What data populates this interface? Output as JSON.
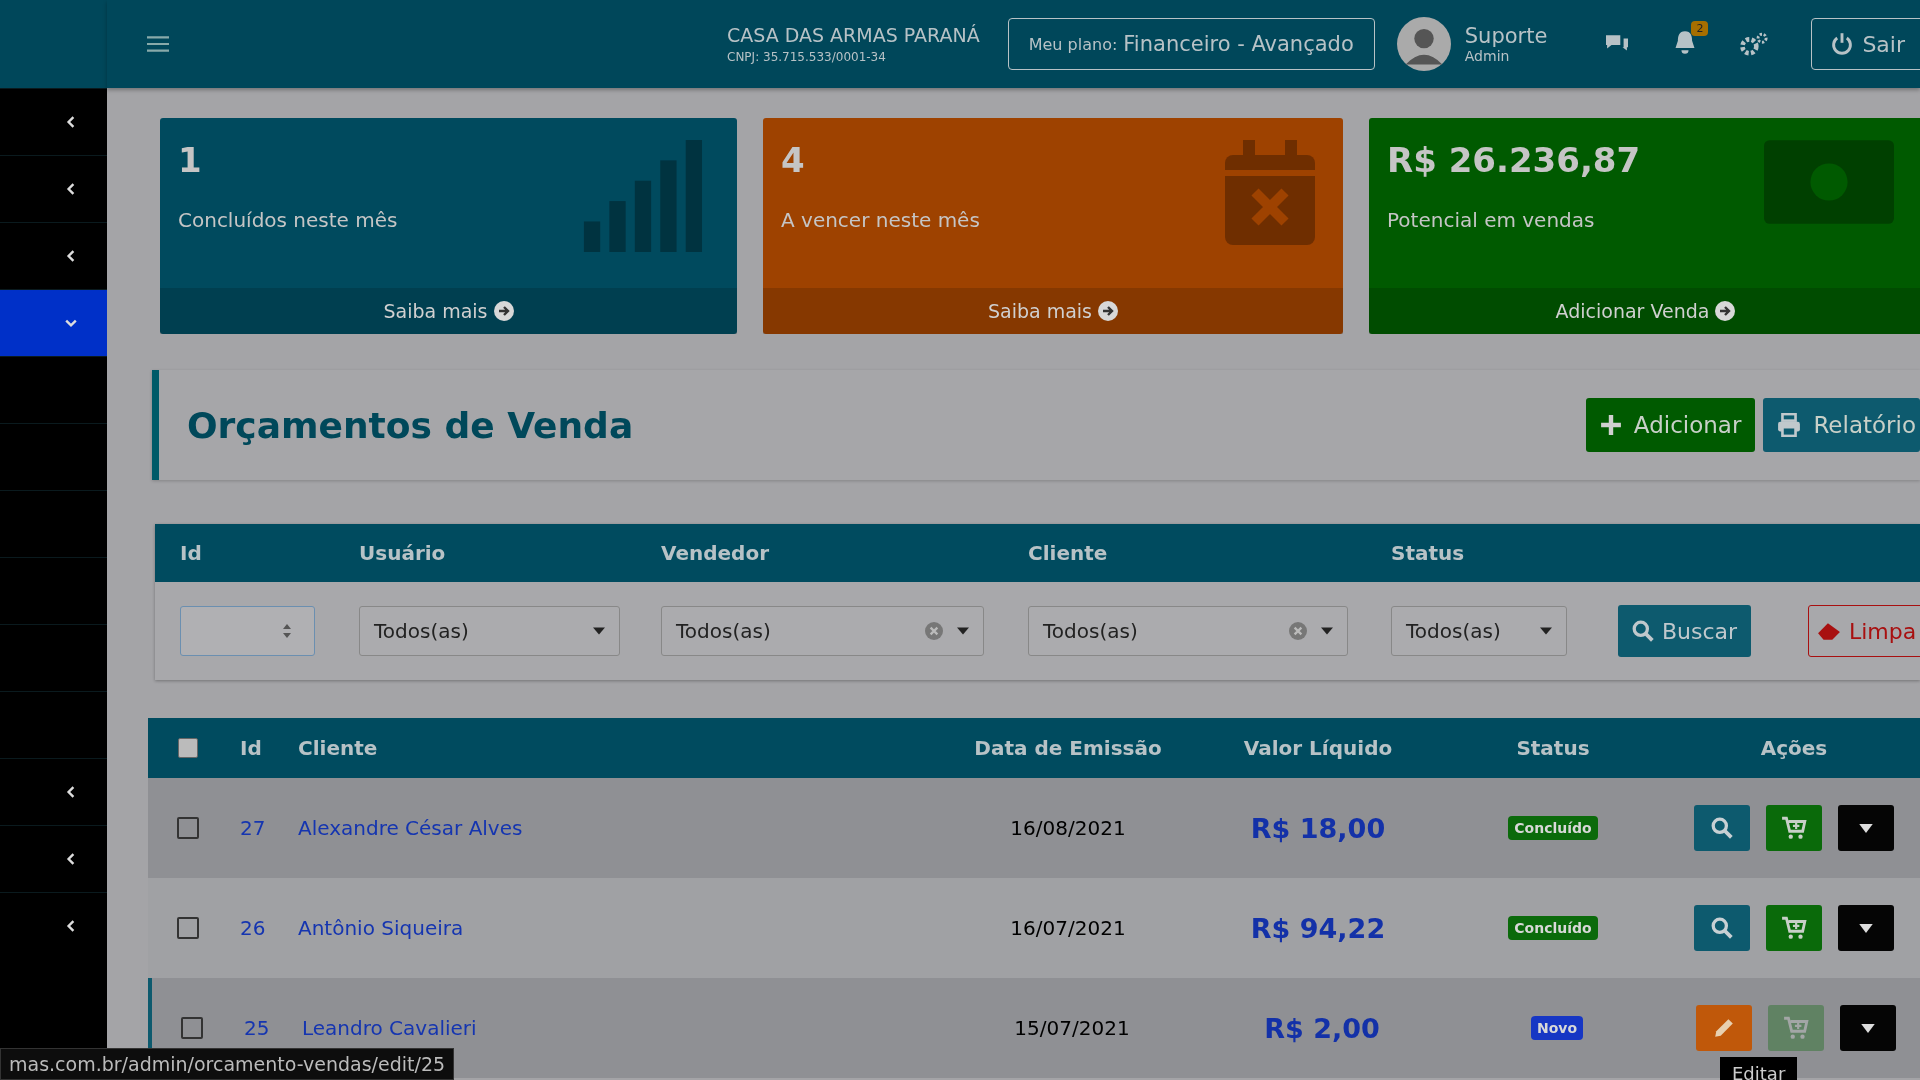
{
  "topbar": {
    "company": "CASA DAS ARMAS PARANÁ",
    "cnpj": "CNPJ: 35.715.533/0001-34",
    "plan_label": "Meu plano:",
    "plan": "Financeiro - Avançado",
    "user_name": "Suporte",
    "user_role": "Admin",
    "notification_count": "2",
    "logout": "Sair"
  },
  "sidebar": {
    "items": [
      {
        "kind": "group",
        "expanded": false,
        "selected": false
      },
      {
        "kind": "group",
        "expanded": false,
        "selected": false
      },
      {
        "kind": "group",
        "expanded": false,
        "selected": false
      },
      {
        "kind": "group",
        "expanded": true,
        "selected": true
      },
      {
        "kind": "link",
        "selected": false
      },
      {
        "kind": "link",
        "selected": false
      },
      {
        "kind": "link",
        "selected": false
      },
      {
        "kind": "link",
        "selected": false
      },
      {
        "kind": "link",
        "selected": false
      },
      {
        "kind": "link",
        "selected": false
      },
      {
        "kind": "group",
        "expanded": false,
        "selected": false
      },
      {
        "kind": "group",
        "expanded": false,
        "selected": false
      },
      {
        "kind": "group",
        "expanded": false,
        "selected": false
      }
    ]
  },
  "cards": [
    {
      "kind": "bars",
      "value": "1",
      "label": "Concluídos neste mês",
      "link": "Saiba mais",
      "color": "#004a5e"
    },
    {
      "kind": "calendar",
      "value": "4",
      "label": "A vencer neste mês",
      "link": "Saiba mais",
      "color": "#9e4200"
    },
    {
      "kind": "money",
      "value": "R$ 26.236,87",
      "label": "Potencial em vendas",
      "link": "Adicionar Venda",
      "color": "#005a00"
    }
  ],
  "page": {
    "title": "Orçamentos de Venda",
    "buttons": [
      {
        "kind": "add",
        "label": "Adicionar"
      },
      {
        "kind": "print",
        "label": "Relatório"
      }
    ]
  },
  "filters": {
    "fields": [
      {
        "kind": "number",
        "label": "Id"
      },
      {
        "kind": "select",
        "label": "Usuário",
        "value": "Todos(as)",
        "clearable": false
      },
      {
        "kind": "select",
        "label": "Vendedor",
        "value": "Todos(as)",
        "clearable": true
      },
      {
        "kind": "select",
        "label": "Cliente",
        "value": "Todos(as)",
        "clearable": true
      },
      {
        "kind": "select",
        "label": "Status",
        "value": "Todos(as)",
        "clearable": false
      }
    ],
    "buttons": [
      {
        "kind": "search",
        "label": "Buscar"
      },
      {
        "kind": "clear",
        "label": "Limpa"
      }
    ]
  },
  "table": {
    "all_checked": false,
    "columns": [
      "Id",
      "Cliente",
      "Data de Emissão",
      "Valor Líquido",
      "Status",
      "Ações"
    ],
    "rows": [
      {
        "checked": false,
        "id": "27",
        "client": "Alexandre César Alves",
        "date": "16/08/2021",
        "value": "R$ 18,00",
        "status": {
          "label": "Concluído",
          "color": "#0b6a0b"
        },
        "actions": [
          {
            "kind": "view",
            "disabled": false
          },
          {
            "kind": "cart",
            "disabled": false
          },
          {
            "kind": "menu",
            "disabled": false
          }
        ]
      },
      {
        "checked": false,
        "id": "26",
        "client": "Antônio Siqueira",
        "date": "16/07/2021",
        "value": "R$ 94,22",
        "status": {
          "label": "Concluído",
          "color": "#0b6a0b"
        },
        "actions": [
          {
            "kind": "view",
            "disabled": false
          },
          {
            "kind": "cart",
            "disabled": false
          },
          {
            "kind": "menu",
            "disabled": false
          }
        ]
      },
      {
        "checked": false,
        "id": "25",
        "client": "Leandro Cavalieri",
        "date": "15/07/2021",
        "value": "R$ 2,00",
        "status": {
          "label": "Novo",
          "color": "#1636c4"
        },
        "tooltip": "Editar",
        "actions": [
          {
            "kind": "edit",
            "disabled": false
          },
          {
            "kind": "cart",
            "disabled": true
          },
          {
            "kind": "menu",
            "disabled": false
          }
        ]
      }
    ]
  },
  "status_bar": {
    "url": "mas.com.br/admin/orcamento-vendas/edit/25"
  }
}
